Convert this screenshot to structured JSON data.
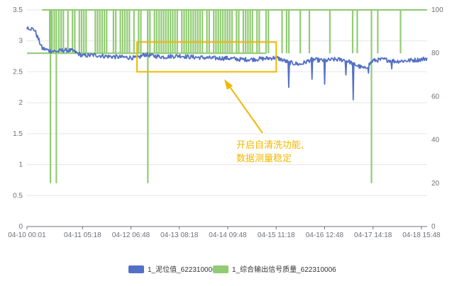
{
  "chart_data": {
    "type": "line",
    "left_axis": {
      "min": 0,
      "max": 3.5,
      "ticks": [
        "0",
        "0.5",
        "1",
        "1.5",
        "2",
        "2.5",
        "3",
        "3.5"
      ]
    },
    "right_axis": {
      "min": 0,
      "max": 100,
      "ticks": [
        "0",
        "20",
        "40",
        "60",
        "80",
        "100"
      ]
    },
    "x_axis": {
      "start": "04-10 00:01",
      "end": "04-18 18:50",
      "tick_labels": [
        "04-10 00:01",
        "04-11 05:18",
        "04-12 06:48",
        "04-13 08:18",
        "04-14 09:48",
        "04-15 11:18",
        "04-16 12:48",
        "04-17 14:18",
        "04-18 15:48"
      ]
    },
    "grid": true,
    "series": [
      {
        "name": "1_泥位值_622310006",
        "axis": "left",
        "color": "#5470c6",
        "x": [
          "04-10 00:01",
          "04-10 04:00",
          "04-10 08:00",
          "04-10 12:00",
          "04-10 16:00",
          "04-10 20:00",
          "04-11 00:00",
          "04-11 05:18",
          "04-11 12:00",
          "04-11 18:00",
          "04-12 00:00",
          "04-12 06:48",
          "04-12 10:00",
          "04-12 14:00",
          "04-12 18:00",
          "04-13 00:00",
          "04-13 08:18",
          "04-13 14:00",
          "04-13 20:00",
          "04-14 02:00",
          "04-14 09:48",
          "04-14 16:00",
          "04-14 22:00",
          "04-15 04:00",
          "04-15 11:18",
          "04-15 18:00",
          "04-16 00:00",
          "04-16 06:00",
          "04-16 12:48",
          "04-16 18:00",
          "04-17 00:00",
          "04-17 06:00",
          "04-17 10:00",
          "04-17 14:18",
          "04-17 20:00",
          "04-18 02:00",
          "04-18 08:00",
          "04-18 15:48",
          "04-18 18:50"
        ],
        "y": [
          3.22,
          3.18,
          2.88,
          2.84,
          2.83,
          2.85,
          2.84,
          2.76,
          2.77,
          2.75,
          2.74,
          2.73,
          2.72,
          2.78,
          2.76,
          2.74,
          2.76,
          2.74,
          2.73,
          2.72,
          2.72,
          2.7,
          2.7,
          2.71,
          2.73,
          2.65,
          2.62,
          2.7,
          2.68,
          2.7,
          2.69,
          2.6,
          2.55,
          2.68,
          2.7,
          2.67,
          2.68,
          2.7,
          2.72
        ],
        "dips": [
          [
            "04-15 18:00",
            2.25
          ],
          [
            "04-16 06:00",
            2.38
          ],
          [
            "04-16 12:48",
            2.3
          ],
          [
            "04-17 00:00",
            2.45
          ],
          [
            "04-17 04:00",
            2.05
          ],
          [
            "04-17 12:00",
            2.48
          ],
          [
            "04-18 00:00",
            2.55
          ]
        ]
      },
      {
        "name": "1_综合输出信号质量_622310006",
        "axis": "right",
        "color": "#91cc75",
        "values_between": [
          80,
          100
        ],
        "baseline_segments": [
          [
            "04-10 00:01",
            "04-10 08:00",
            80
          ],
          [
            "04-10 08:00",
            "04-18 18:50",
            100
          ]
        ],
        "drops_to_20": [
          "04-10 12:24",
          "04-10 15:30",
          "04-12 15:40",
          "04-17 13:30"
        ]
      }
    ],
    "annotation": {
      "text_lines": [
        "开启自清洗功能,",
        "数据测量稳定"
      ],
      "box_range_x": [
        "04-12 10:00",
        "04-15 11:18"
      ],
      "box_range_y": [
        2.5,
        2.98
      ],
      "color": "#f0b800"
    }
  }
}
